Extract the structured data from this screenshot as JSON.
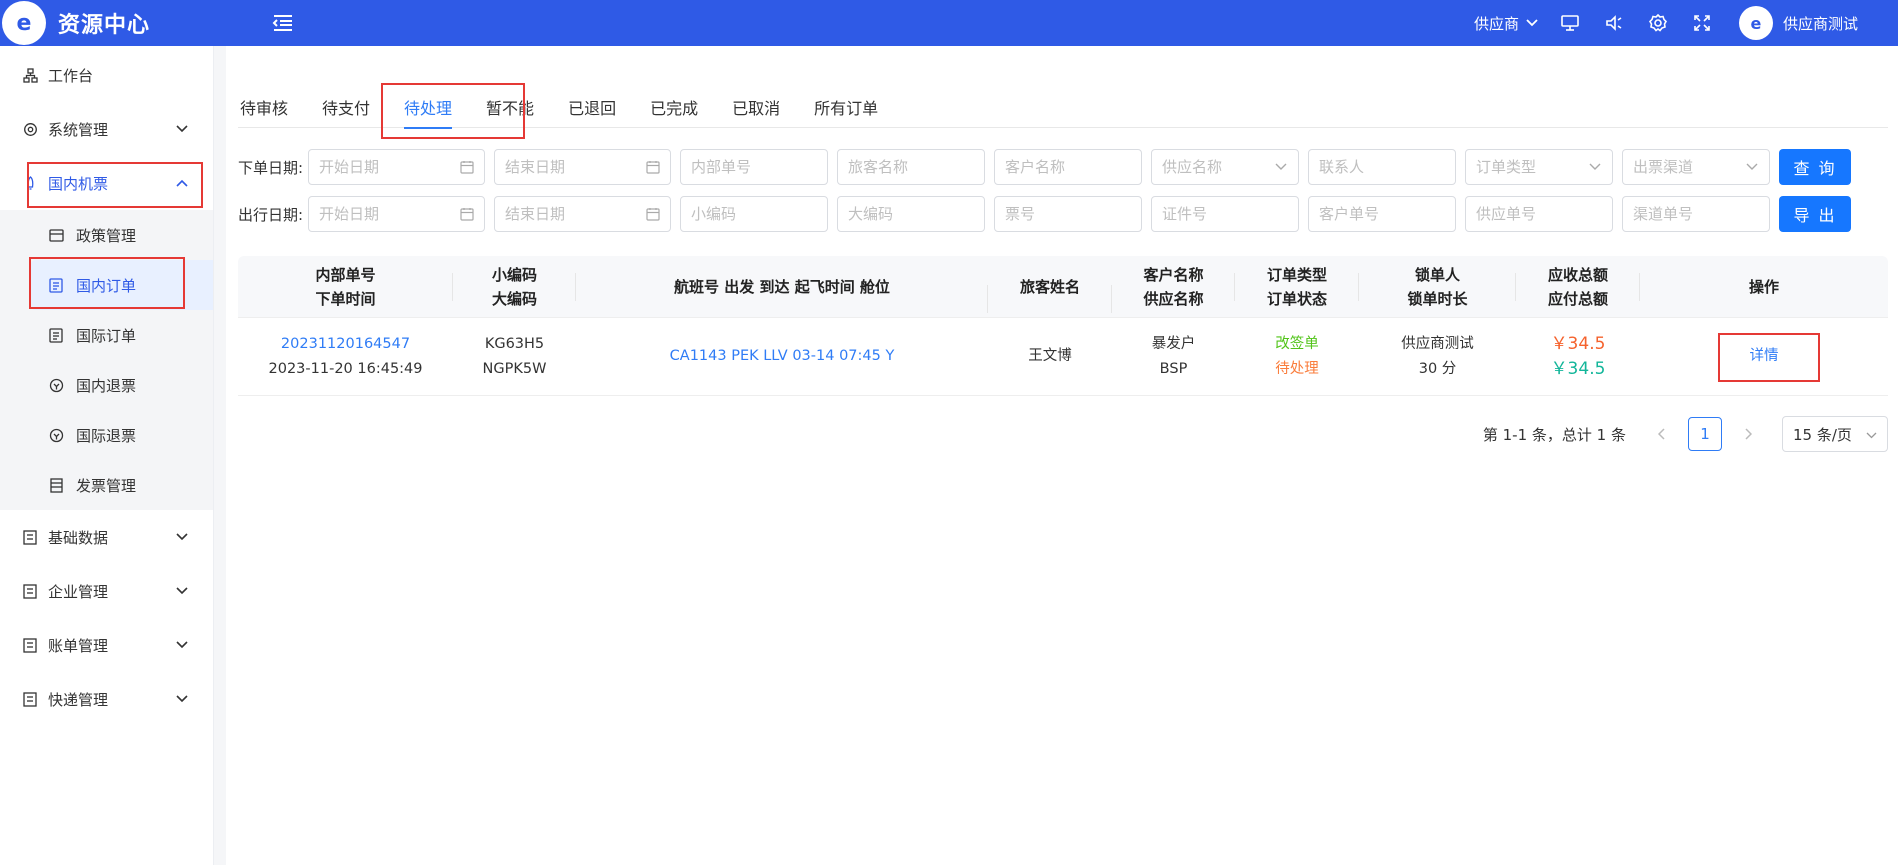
{
  "app": {
    "title": "资源中心",
    "logo_text": "e"
  },
  "header": {
    "supplier_label": "供应商",
    "user_name": "供应商测试",
    "icons": [
      "menu-collapse-icon",
      "monitor-icon",
      "speaker-icon",
      "gear-icon",
      "fullscreen-icon"
    ]
  },
  "sidebar": {
    "items": [
      {
        "label": "工作台",
        "icon": "sitemap-icon"
      },
      {
        "label": "系统管理",
        "icon": "gear-icon"
      },
      {
        "label": "国内机票",
        "icon": "rocket-icon"
      },
      {
        "label": "基础数据",
        "icon": "doc-icon"
      },
      {
        "label": "企业管理",
        "icon": "doc-icon"
      },
      {
        "label": "账单管理",
        "icon": "doc-icon"
      },
      {
        "label": "快递管理",
        "icon": "doc-icon"
      }
    ],
    "sub": [
      {
        "label": "政策管理",
        "icon": "card-icon"
      },
      {
        "label": "国内订单",
        "icon": "list-icon"
      },
      {
        "label": "国际订单",
        "icon": "list-icon"
      },
      {
        "label": "国内退票",
        "icon": "refund-icon"
      },
      {
        "label": "国际退票",
        "icon": "refund-icon"
      },
      {
        "label": "发票管理",
        "icon": "invoice-icon"
      }
    ]
  },
  "tabs": [
    "待审核",
    "待支付",
    "待处理",
    "暂不能",
    "已退回",
    "已完成",
    "已取消",
    "所有订单"
  ],
  "filters": {
    "row1_label": "下单日期:",
    "row2_label": "出行日期:",
    "start_date": "开始日期",
    "end_date": "结束日期",
    "row1": [
      "内部单号",
      "旅客名称",
      "客户名称",
      "供应名称",
      "联系人",
      "订单类型",
      "出票渠道"
    ],
    "row2": [
      "小编码",
      "大编码",
      "票号",
      "证件号",
      "客户单号",
      "供应单号",
      "渠道单号"
    ],
    "search_btn": "查 询",
    "export_btn": "导 出"
  },
  "table": {
    "headers": {
      "c1a": "内部单号",
      "c1b": "下单时间",
      "c2a": "小编码",
      "c2b": "大编码",
      "c3": "航班号 出发 到达 起飞时间 舱位",
      "c4": "旅客姓名",
      "c5a": "客户名称",
      "c5b": "供应名称",
      "c6a": "订单类型",
      "c6b": "订单状态",
      "c7a": "锁单人",
      "c7b": "锁单时长",
      "c8a": "应收总额",
      "c8b": "应付总额",
      "c9": "操作"
    },
    "rows": [
      {
        "order_no": "20231120164547",
        "order_time": "2023-11-20 16:45:49",
        "small_code": "KG63H5",
        "big_code": "NGPK5W",
        "flight": "CA1143 PEK LLV 03-14 07:45 Y",
        "passenger": "王文博",
        "customer": "暴发户",
        "supplier": "BSP",
        "order_type": "改签单",
        "order_status": "待处理",
        "locker": "供应商测试",
        "lock_duration": "30 分",
        "receivable": "￥34.5",
        "payable": "￥34.5",
        "action": "详情"
      }
    ]
  },
  "pagination": {
    "total_text": "第 1-1 条，总计 1 条",
    "current": "1",
    "page_size": "15 条/页"
  },
  "colors": {
    "primary": "#2f5ae6",
    "link": "#2f7cf6",
    "highlight": "#e53935"
  }
}
